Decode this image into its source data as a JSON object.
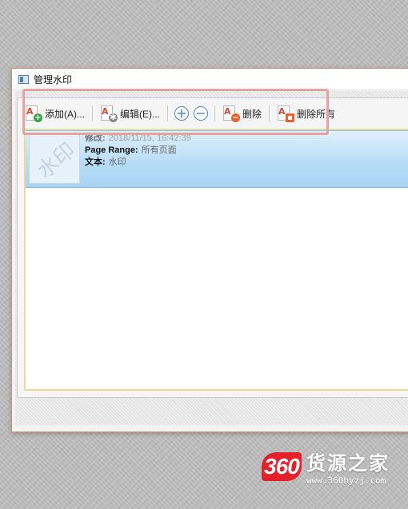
{
  "window": {
    "title": "管理水印"
  },
  "toolbar": {
    "add_label": "添加(A)...",
    "edit_label": "编辑(E)...",
    "zoom_in_symbol": "+",
    "zoom_out_symbol": "−",
    "delete_label": "删除",
    "delete_all_label": "删除所有"
  },
  "watermark_item": {
    "thumbnail_text": "水印",
    "modified_label": "修改:",
    "modified_value": "2018/11/15, 16:42:39",
    "page_range_label": "Page Range:",
    "page_range_value": "所有页面",
    "text_label": "文本:",
    "text_value": "水印"
  },
  "logo": {
    "badge": "360",
    "name": "货源之家",
    "url": "www.360hyzj.com"
  },
  "colors": {
    "highlight_border": "#e6a2a2",
    "selected_row": "#b6dbf6",
    "brand_red": "#e4202a"
  }
}
